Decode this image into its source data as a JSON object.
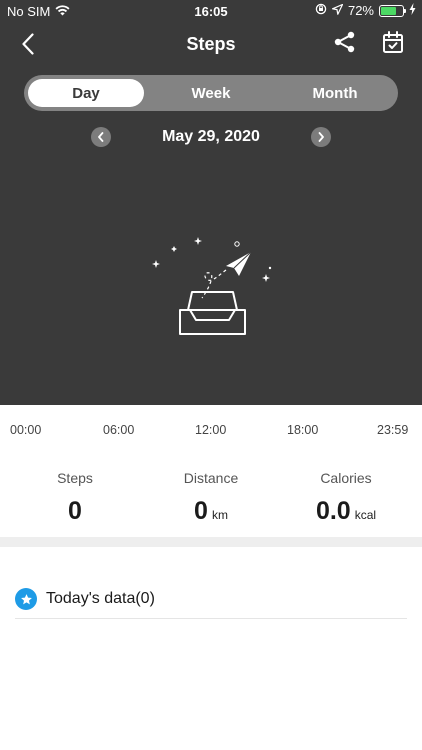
{
  "status_bar": {
    "carrier": "No SIM",
    "time": "16:05",
    "battery_percent": "72%",
    "battery_level": 0.72,
    "icons": [
      "wifi-icon",
      "orientation-lock-icon",
      "location-icon",
      "battery-icon",
      "charging-icon"
    ]
  },
  "navbar": {
    "title": "Steps",
    "icons": [
      "back-icon",
      "share-icon",
      "calendar-check-icon"
    ]
  },
  "segments": {
    "items": [
      "Day",
      "Week",
      "Month"
    ],
    "selected": "Day"
  },
  "date_nav": {
    "date": "May 29, 2020"
  },
  "timeline": {
    "ticks": [
      "00:00",
      "06:00",
      "12:00",
      "18:00",
      "23:59"
    ]
  },
  "stats": {
    "steps": {
      "label": "Steps",
      "value": "0"
    },
    "distance": {
      "label": "Distance",
      "value": "0",
      "unit": "km"
    },
    "calories": {
      "label": "Calories",
      "value": "0.0",
      "unit": "kcal"
    }
  },
  "today": {
    "label": "Today's data(0)"
  },
  "colors": {
    "header_bg": "#3a3a3a",
    "segment_bg": "#838383",
    "accent_blue": "#1e9be6",
    "battery_green": "#4cd964"
  }
}
